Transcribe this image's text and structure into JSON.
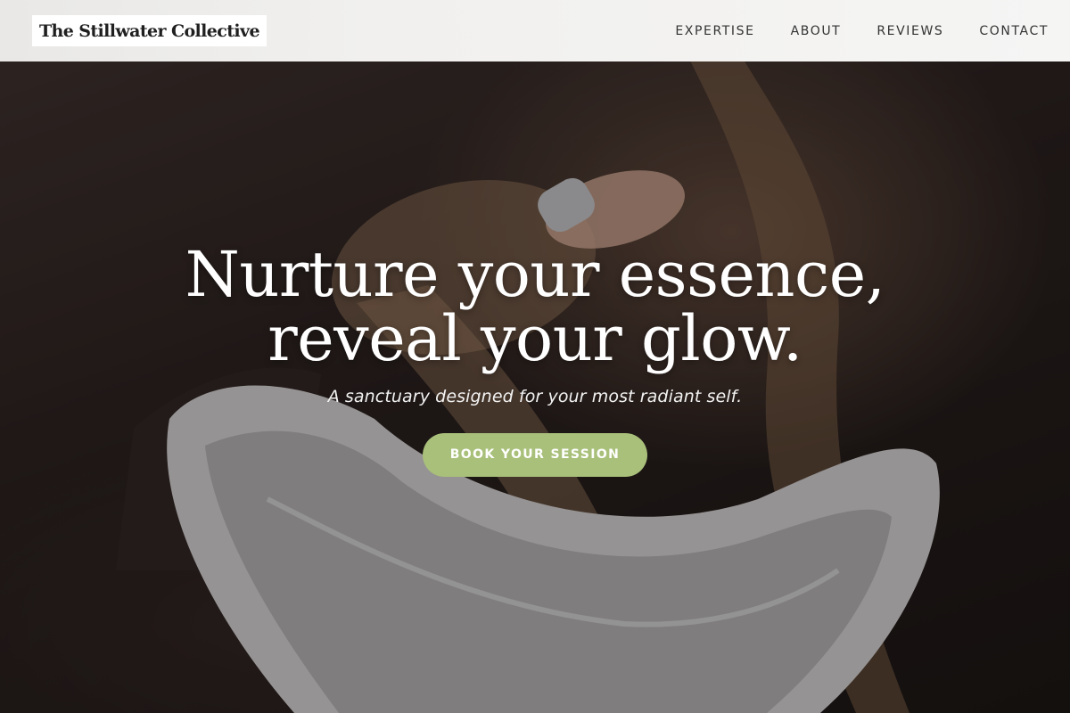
{
  "brand": {
    "name": "The Stillwater Collective"
  },
  "nav": {
    "items": [
      {
        "label": "EXPERTISE"
      },
      {
        "label": "ABOUT"
      },
      {
        "label": "REVIEWS"
      },
      {
        "label": "CONTACT"
      }
    ]
  },
  "hero": {
    "title_line1": "Nurture your essence,",
    "title_line2": "reveal your glow.",
    "subtitle": "A sanctuary designed for your most radiant self.",
    "cta_label": "BOOK YOUR SESSION",
    "background": "salon-hair-wash-photo"
  },
  "colors": {
    "cta": "#a9c07a",
    "header_bg": "#f3f3f2",
    "text_light": "#ffffff",
    "nav_text": "#333333"
  }
}
